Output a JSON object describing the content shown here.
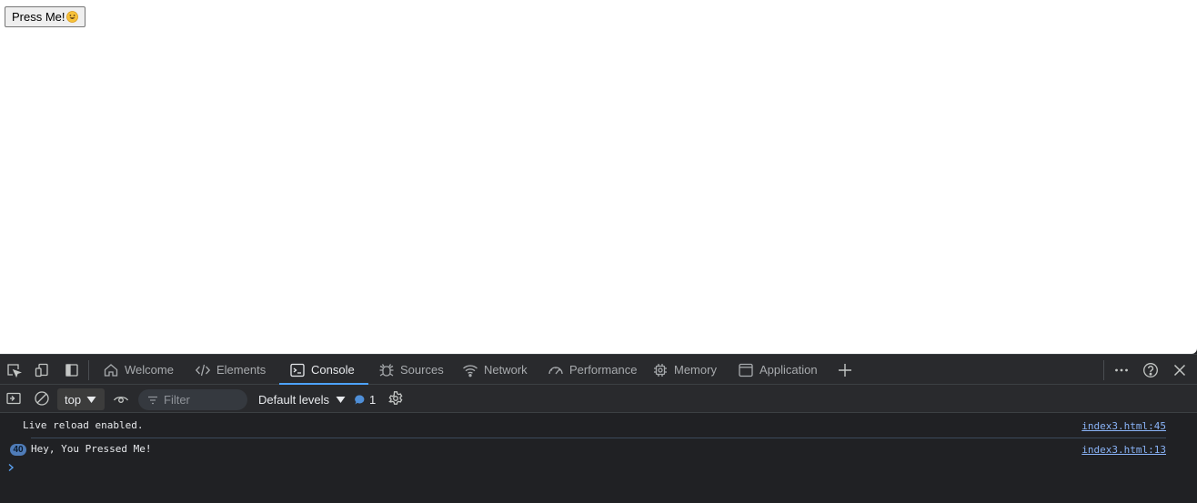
{
  "page": {
    "button_label": "Press Me!",
    "button_emoji": "grinning-face"
  },
  "devtools": {
    "tabs": [
      {
        "label": "Welcome",
        "icon": "home-icon"
      },
      {
        "label": "Elements",
        "icon": "code-icon"
      },
      {
        "label": "Console",
        "icon": "console-icon",
        "active": true
      },
      {
        "label": "Sources",
        "icon": "bug-icon"
      },
      {
        "label": "Network",
        "icon": "wifi-icon"
      },
      {
        "label": "Performance",
        "icon": "gauge-icon"
      },
      {
        "label": "Memory",
        "icon": "chip-icon"
      },
      {
        "label": "Application",
        "icon": "window-icon"
      }
    ],
    "toolbar": {
      "context": "top",
      "filter_placeholder": "Filter",
      "levels": "Default levels",
      "issues_count": "1"
    },
    "console": {
      "messages": [
        {
          "text": "Live reload enabled.",
          "source": "index3.html:45"
        },
        {
          "text": "Hey, You Pressed Me!",
          "source": "index3.html:13",
          "repeat_count": "40"
        }
      ]
    },
    "colors": {
      "accent": "#4da3ff",
      "link": "#8ab4f8",
      "background": "#202124"
    }
  }
}
